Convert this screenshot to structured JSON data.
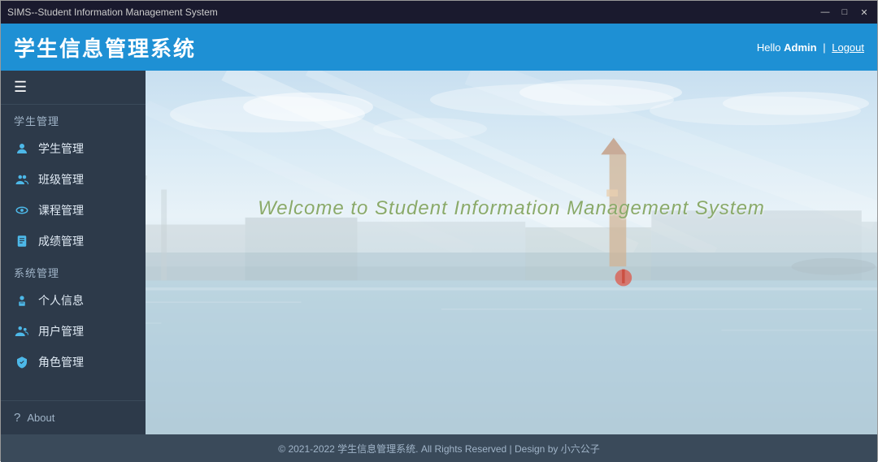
{
  "window": {
    "title": "SIMS--Student Information Management System",
    "controls": {
      "minimize": "—",
      "maximize": "□",
      "close": "✕"
    }
  },
  "header": {
    "app_title": "学生信息管理系统",
    "hello": "Hello",
    "admin": "Admin",
    "separator": "|",
    "logout": "Logout"
  },
  "sidebar": {
    "toggle_icon": "☰",
    "sections": [
      {
        "label": "学生管理",
        "items": [
          {
            "id": "student-mgmt",
            "label": "学生管理",
            "icon": "person"
          },
          {
            "id": "class-mgmt",
            "label": "班级管理",
            "icon": "group"
          },
          {
            "id": "course-mgmt",
            "label": "课程管理",
            "icon": "eye"
          },
          {
            "id": "score-mgmt",
            "label": "成绩管理",
            "icon": "doc"
          }
        ]
      },
      {
        "label": "系统管理",
        "items": [
          {
            "id": "personal-info",
            "label": "个人信息",
            "icon": "person-badge"
          },
          {
            "id": "user-mgmt",
            "label": "用户管理",
            "icon": "users"
          },
          {
            "id": "role-mgmt",
            "label": "角色管理",
            "icon": "shield"
          }
        ]
      }
    ],
    "about": "About"
  },
  "content": {
    "welcome_text": "Welcome to Student Information Management System"
  },
  "footer": {
    "text": "© 2021-2022 学生信息管理系统. All Rights Reserved | Design by 小六公子"
  }
}
